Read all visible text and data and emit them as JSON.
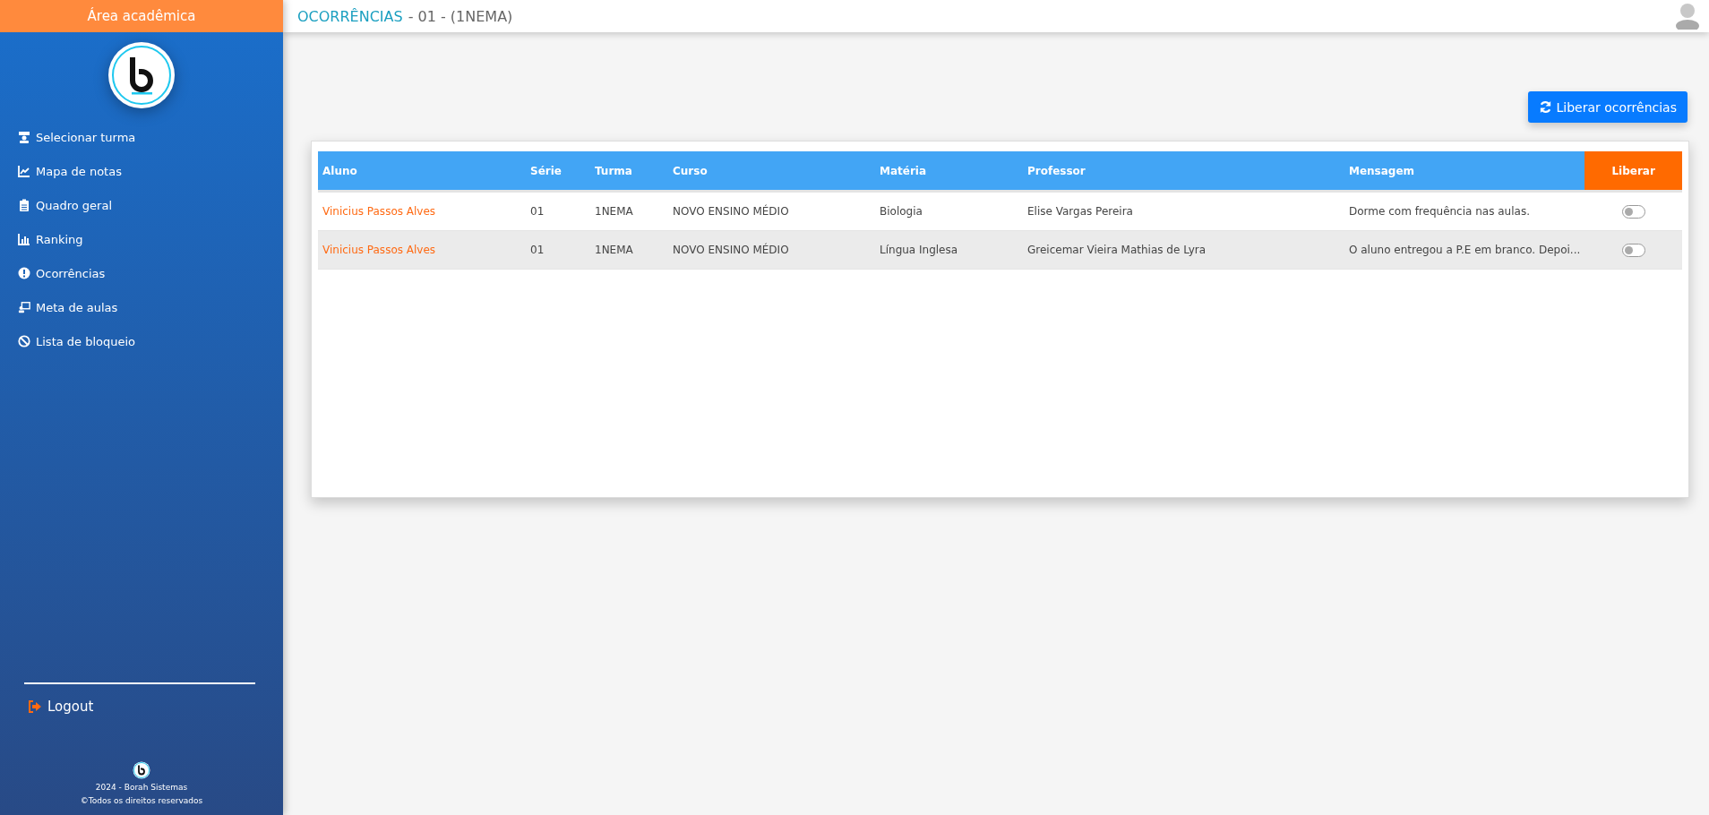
{
  "sidebar": {
    "header": "Área acadêmica",
    "items": [
      {
        "label": "Selecionar turma",
        "kind": "teacher"
      },
      {
        "label": "Mapa de notas",
        "kind": "chart"
      },
      {
        "label": "Quadro geral",
        "kind": "clipboard"
      },
      {
        "label": "Ranking",
        "kind": "bars"
      },
      {
        "label": "Ocorrências",
        "kind": "alert"
      },
      {
        "label": "Meta de aulas",
        "kind": "board"
      },
      {
        "label": "Lista de bloqueio",
        "kind": "ban"
      }
    ],
    "logout": "Logout",
    "footer": [
      "2024 - Borah Sistemas",
      "©Todos os direitos reservados"
    ]
  },
  "topbar": {
    "title_highlight": "OCORRÊNCIAS",
    "title_rest": "- 01 - (1NEMA)"
  },
  "action_button": "Liberar ocorrências",
  "table": {
    "columns": [
      "Aluno",
      "Série",
      "Turma",
      "Curso",
      "Matéria",
      "Professor",
      "Mensagem",
      "Liberar"
    ],
    "rows": [
      {
        "aluno": "Vinicius Passos Alves",
        "serie": "01",
        "turma": "1NEMA",
        "curso": "NOVO ENSINO MÉDIO",
        "materia": "Biologia",
        "professor": "Elise Vargas Pereira",
        "mensagem": "Dorme com frequência nas aulas.",
        "on": false
      },
      {
        "aluno": "Vinicius Passos Alves",
        "serie": "01",
        "turma": "1NEMA",
        "curso": "NOVO ENSINO MÉDIO",
        "materia": "Língua Inglesa",
        "professor": "Greicemar Vieira Mathias de Lyra",
        "mensagem": "O aluno entregou a P.E em branco. Depoi...",
        "on": false
      }
    ]
  }
}
